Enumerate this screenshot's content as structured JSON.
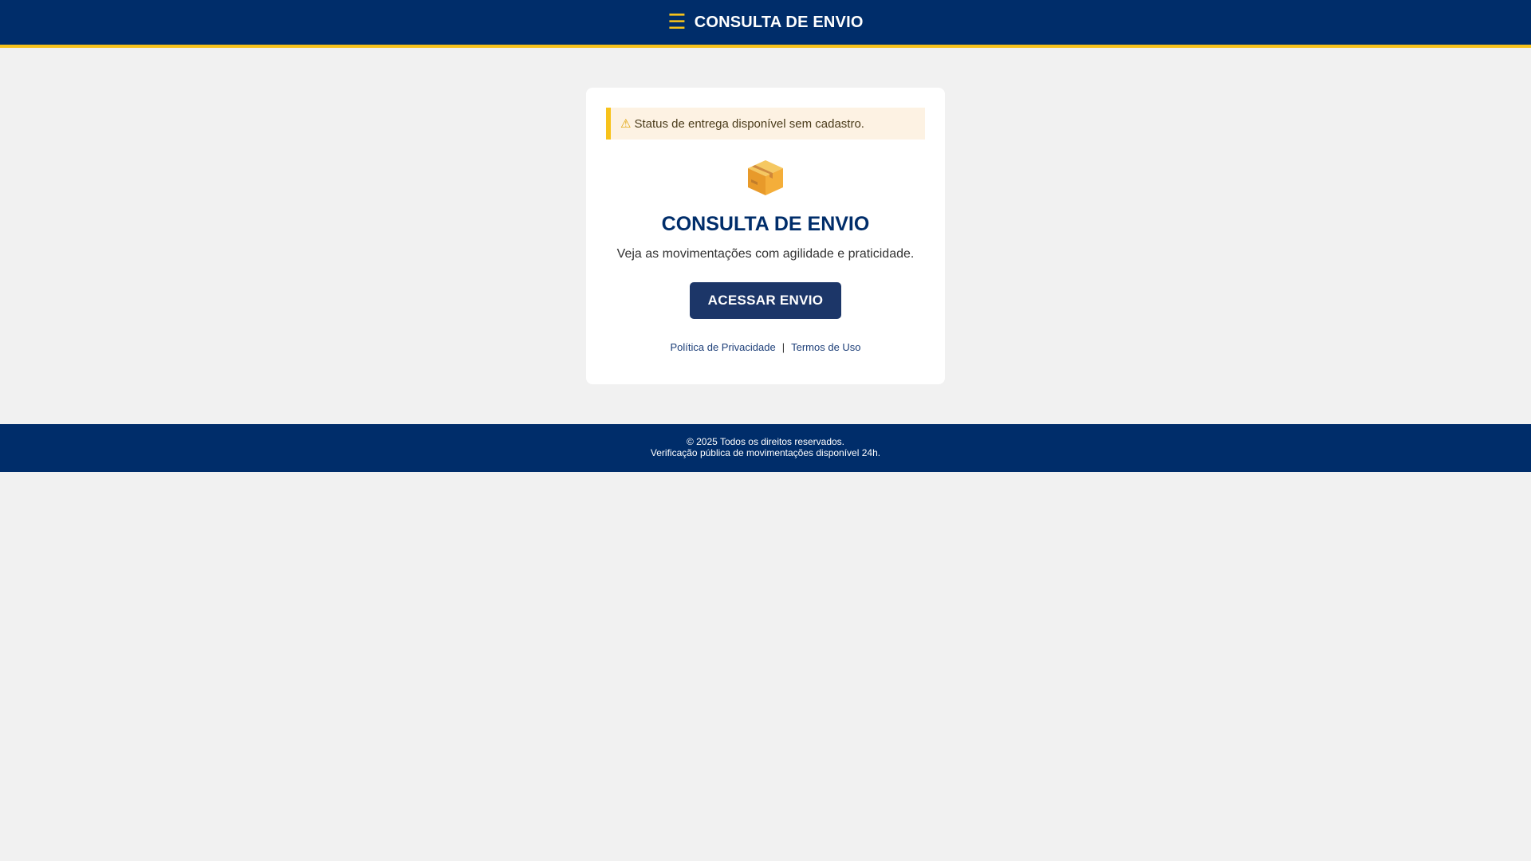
{
  "header": {
    "menu_icon": "menu-icon",
    "title": "CONSULTA DE ENVIO"
  },
  "card": {
    "alert": {
      "icon": "warning-icon",
      "text": "Status de entrega disponível sem cadastro."
    },
    "box_icon": "package-icon",
    "title": "CONSULTA DE ENVIO",
    "subtitle": "Veja as movimentações com agilidade e praticidade.",
    "button_label": "ACESSAR ENVIO",
    "links": {
      "privacy": "Política de Privacidade",
      "separator": "|",
      "terms": "Termos de Uso"
    }
  },
  "footer": {
    "line1": "© 2025 Todos os direitos reservados.",
    "line2": "Verificação pública de movimentações disponível 24h."
  },
  "colors": {
    "brand_navy": "#002d6a",
    "accent_yellow": "#f7c21b",
    "button": "#1c3668",
    "alert_bg": "#fdf2e3",
    "page_bg": "#f1f1f1"
  }
}
